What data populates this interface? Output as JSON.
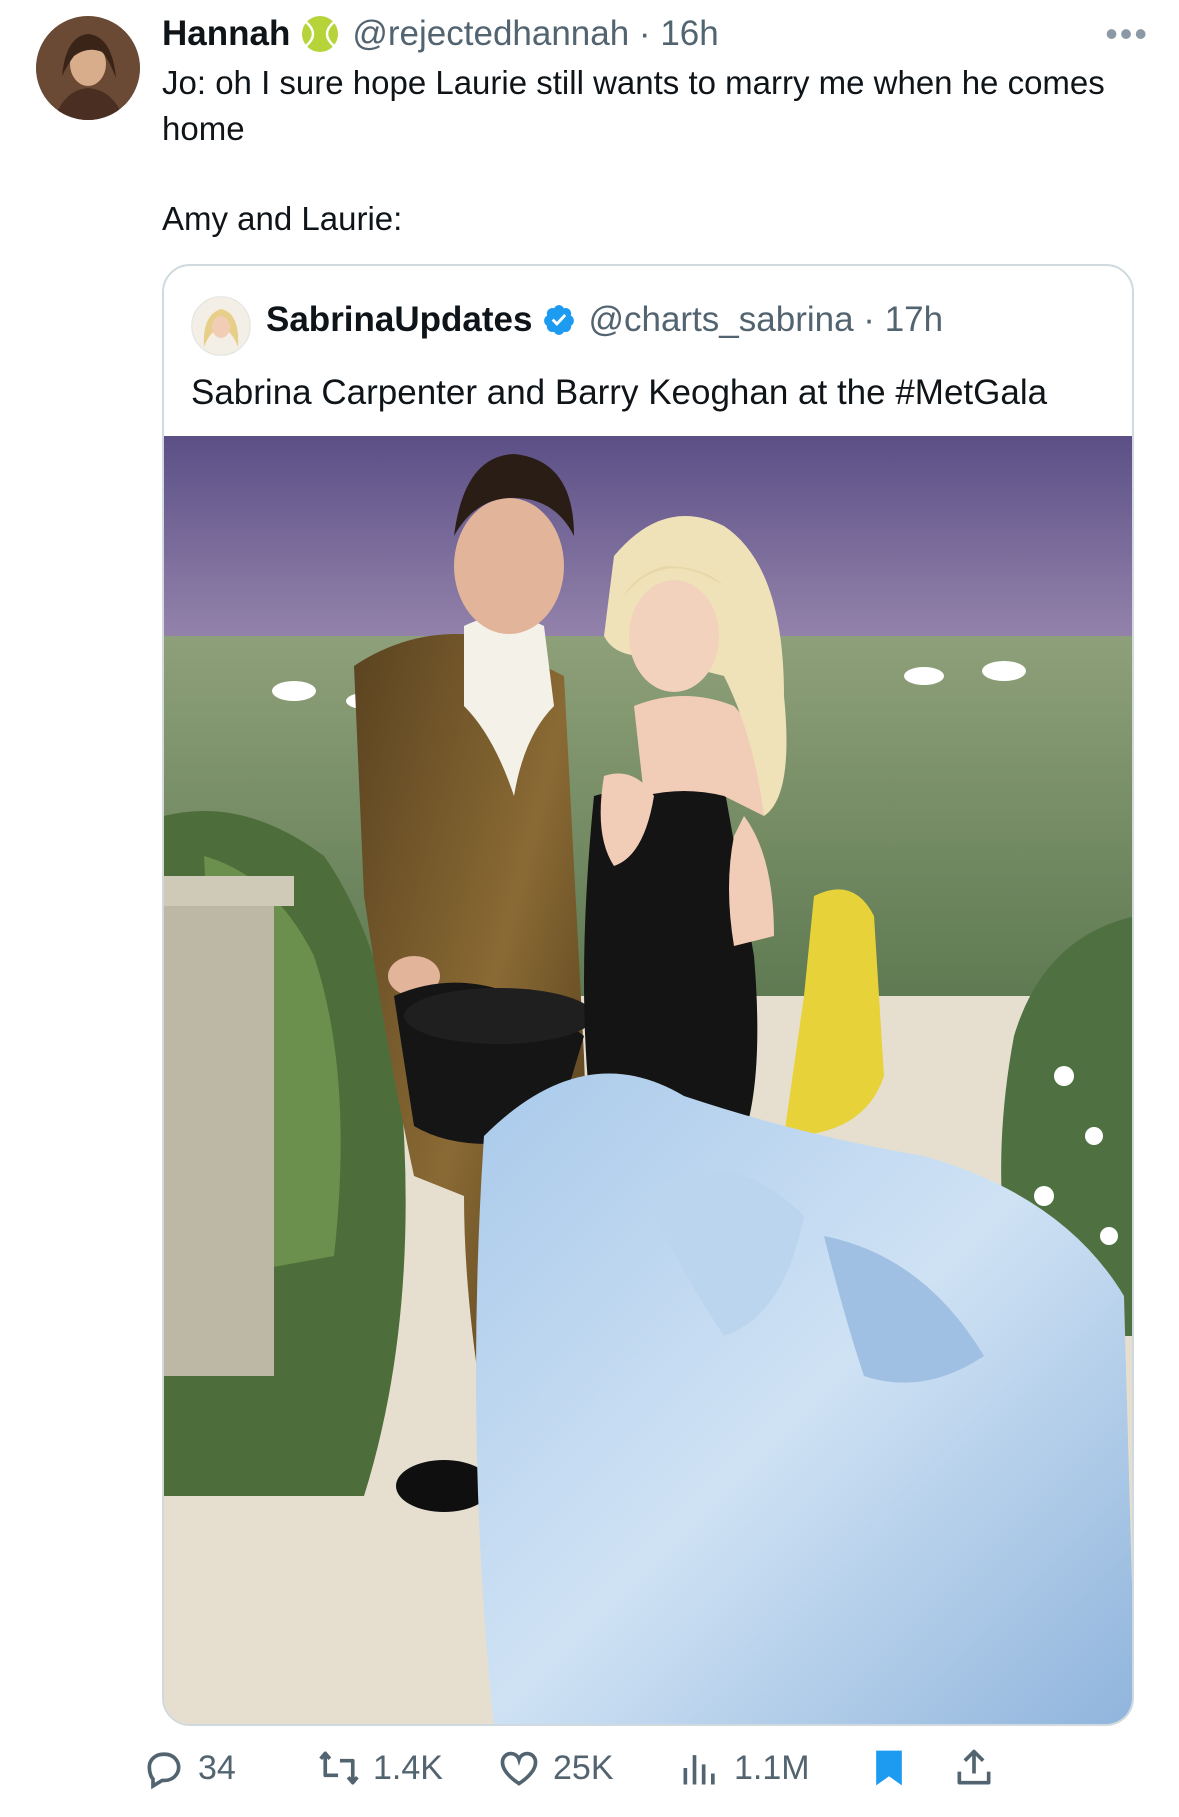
{
  "tweet": {
    "display_name": "Hannah",
    "handle": "@rejectedhannah",
    "separator": " · ",
    "time": "16h",
    "text_line1": "Jo: oh I sure hope Laurie still wants to marry me when he comes home",
    "text_line2": "Amy and Laurie:",
    "badge_icon": "tennis-ball-icon",
    "more_icon": "more-icon"
  },
  "quote": {
    "display_name": "SabrinaUpdates",
    "handle": "@charts_sabrina",
    "separator": " · ",
    "time": "17h",
    "text": "Sabrina Carpenter and Barry Keoghan at the #MetGala",
    "verified_icon": "verified-badge-icon",
    "verified_color": "#1d9bf0"
  },
  "actions": {
    "reply_count": "34",
    "retweet_count": "1.4K",
    "like_count": "25K",
    "views_count": "1.1M",
    "bookmark_color": "#1d9bf0"
  }
}
